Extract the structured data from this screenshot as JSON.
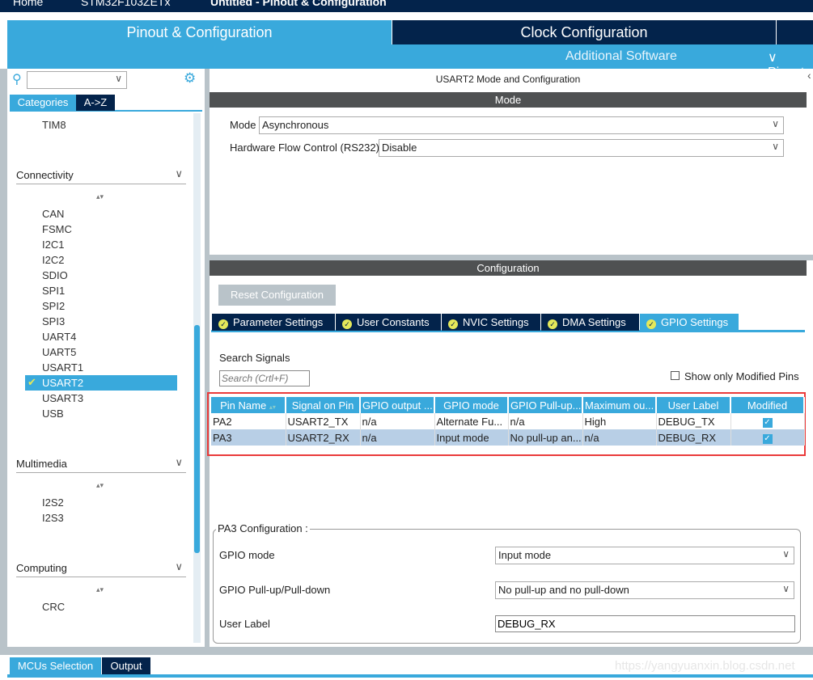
{
  "breadcrumb": [
    "Home",
    "STM32F103ZETx",
    "Untitled - Pinout & Configuration"
  ],
  "main_tabs": [
    "Pinout & Configuration",
    "Clock Configuration"
  ],
  "subbar": {
    "additional_software": "Additional Software",
    "pinout": "Pinout"
  },
  "left": {
    "tabs": [
      "Categories",
      "A->Z"
    ],
    "timer_items": [
      "TIM8"
    ],
    "connectivity": {
      "label": "Connectivity",
      "items": [
        "CAN",
        "FSMC",
        "I2C1",
        "I2C2",
        "SDIO",
        "SPI1",
        "SPI2",
        "SPI3",
        "UART4",
        "UART5",
        "USART1",
        "USART2",
        "USART3",
        "USB"
      ],
      "selected": "USART2"
    },
    "multimedia": {
      "label": "Multimedia",
      "items": [
        "I2S2",
        "I2S3"
      ]
    },
    "computing": {
      "label": "Computing",
      "items": [
        "CRC"
      ]
    }
  },
  "panel_title": "USART2 Mode and Configuration",
  "mode": {
    "header": "Mode",
    "mode_label": "Mode",
    "mode_value": "Asynchronous",
    "flow_label": "Hardware Flow Control (RS232)",
    "flow_value": "Disable"
  },
  "config": {
    "header": "Configuration",
    "reset": "Reset Configuration",
    "tabs": [
      "Parameter Settings",
      "User Constants",
      "NVIC Settings",
      "DMA Settings",
      "GPIO Settings"
    ],
    "active_tab": "GPIO Settings",
    "search_label": "Search Signals",
    "search_placeholder": "Search (Crtl+F)",
    "show_modified": "Show only Modified Pins",
    "columns": [
      "Pin Name",
      "Signal on Pin",
      "GPIO output ...",
      "GPIO mode",
      "GPIO Pull-up...",
      "Maximum ou...",
      "User Label",
      "Modified"
    ],
    "rows": [
      [
        "PA2",
        "USART2_TX",
        "n/a",
        "Alternate Fu...",
        "n/a",
        "High",
        "DEBUG_TX",
        true
      ],
      [
        "PA3",
        "USART2_RX",
        "n/a",
        "Input mode",
        "No pull-up an...",
        "n/a",
        "DEBUG_RX",
        true
      ]
    ],
    "pin_cfg": {
      "title": "PA3 Configuration :",
      "gpio_mode_label": "GPIO mode",
      "gpio_mode": "Input mode",
      "pull_label": "GPIO Pull-up/Pull-down",
      "pull": "No pull-up and no pull-down",
      "user_label_label": "User Label",
      "user_label": "DEBUG_RX"
    }
  },
  "bottom_tabs": [
    "MCUs Selection",
    "Output"
  ],
  "watermark": "https://yangyuanxin.blog.csdn.net",
  "colors": {
    "navy": "#03234b",
    "accent": "#39a9dc",
    "highlight": "#ea3a3a"
  }
}
